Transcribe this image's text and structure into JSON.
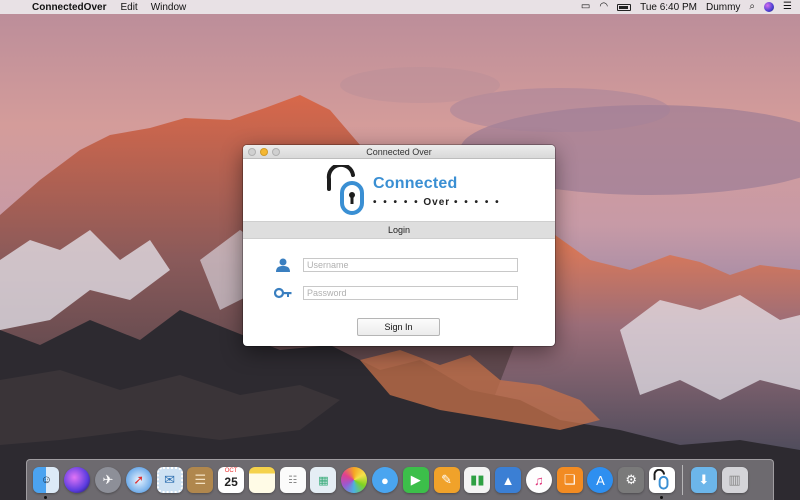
{
  "menubar": {
    "app_name": "ConnectedOver",
    "menus": [
      "Edit",
      "Window"
    ],
    "time": "Tue 6:40 PM",
    "user": "Dummy"
  },
  "window": {
    "title": "Connected Over",
    "logo": {
      "line1": "Connected",
      "line2": "Over",
      "line2_dots_left": "• • • • •",
      "line2_dots_right": "• • • • •"
    },
    "section_title": "Login",
    "username": {
      "value": "",
      "placeholder": "Username"
    },
    "password": {
      "value": "",
      "placeholder": "Password"
    },
    "signin_label": "Sign In"
  },
  "colors": {
    "brand_blue": "#3a8fd3",
    "logo_dark": "#1d1d1d",
    "minimize_yellow": "#f5b731"
  },
  "dock": {
    "calendar": {
      "month": "OCT",
      "day": "25"
    },
    "items": [
      "finder-icon",
      "siri-icon",
      "launchpad-icon",
      "safari-icon",
      "mail-stamp-icon",
      "contacts-icon",
      "calendar-icon",
      "notes-icon",
      "reminders-icon",
      "preview-icon",
      "photos-icon",
      "messages-icon",
      "facetime-icon",
      "pages-icon",
      "numbers-icon",
      "keynote-icon",
      "itunes-icon",
      "ibooks-icon",
      "app-store-icon",
      "system-preferences-icon",
      "connectedover-icon",
      "downloads-folder-icon",
      "trash-icon"
    ]
  }
}
